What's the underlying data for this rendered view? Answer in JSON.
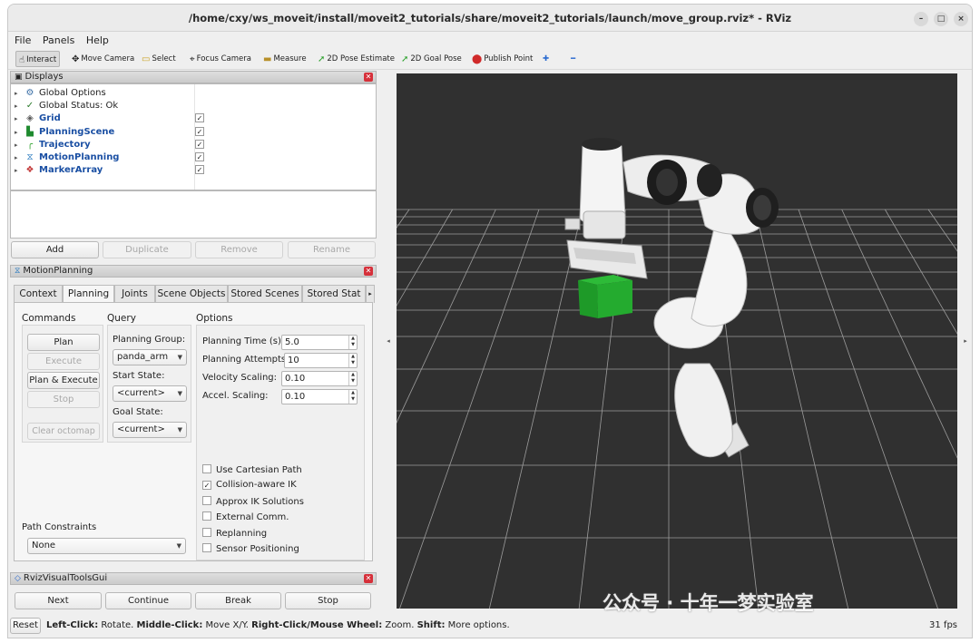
{
  "window": {
    "title": "/home/cxy/ws_moveit/install/moveit2_tutorials/share/moveit2_tutorials/launch/move_group.rviz* - RViz",
    "minimize": "–",
    "maximize": "□",
    "close": "×"
  },
  "menu": [
    "File",
    "Panels",
    "Help"
  ],
  "toolbar": {
    "interact": "Interact",
    "move_camera": "Move Camera",
    "select": "Select",
    "focus_camera": "Focus Camera",
    "measure": "Measure",
    "pose_estimate": "2D Pose Estimate",
    "goal_pose": "2D Goal Pose",
    "publish_point": "Publish Point",
    "plus": "✚",
    "minus": "━"
  },
  "displays": {
    "title": "Displays",
    "items": [
      {
        "label": "Global Options",
        "icon": "gear-icon",
        "glyph": "⚙",
        "color": "#3a6ea5",
        "checked": null
      },
      {
        "label": "Global Status: Ok",
        "icon": "check-icon",
        "glyph": "✓",
        "color": "#2a7a2a",
        "checked": null
      },
      {
        "label": "Grid",
        "icon": "grid-icon",
        "glyph": "◈",
        "color": "#5a5a5a",
        "checked": "✓"
      },
      {
        "label": "PlanningScene",
        "icon": "planning-scene-icon",
        "glyph": "▙",
        "color": "#1e8a2e",
        "checked": "✓"
      },
      {
        "label": "Trajectory",
        "icon": "trajectory-icon",
        "glyph": "╭",
        "color": "#2aa02a",
        "checked": "✓"
      },
      {
        "label": "MotionPlanning",
        "icon": "motion-planning-icon",
        "glyph": "⧖",
        "color": "#2a7ac0",
        "checked": "✓"
      },
      {
        "label": "MarkerArray",
        "icon": "marker-array-icon",
        "glyph": "❖",
        "color": "#c03030",
        "checked": "✓"
      }
    ],
    "buttons": {
      "add": "Add",
      "duplicate": "Duplicate",
      "remove": "Remove",
      "rename": "Rename"
    }
  },
  "motion_planning": {
    "title": "MotionPlanning",
    "tabs": [
      "Context",
      "Planning",
      "Joints",
      "Scene Objects",
      "Stored Scenes",
      "Stored Stat"
    ],
    "active_tab": "Planning",
    "commands_label": "Commands",
    "query_label": "Query",
    "options_label": "Options",
    "plan": "Plan",
    "execute": "Execute",
    "plan_execute": "Plan & Execute",
    "stop": "Stop",
    "clear_octomap": "Clear octomap",
    "planning_group_label": "Planning Group:",
    "planning_group": "panda_arm",
    "start_state_label": "Start State:",
    "start_state": "<current>",
    "goal_state_label": "Goal State:",
    "goal_state": "<current>",
    "planning_time_label": "Planning Time (s):",
    "planning_time": "5.0",
    "planning_attempts_label": "Planning Attempts:",
    "planning_attempts": "10",
    "velocity_scaling_label": "Velocity Scaling:",
    "velocity_scaling": "0.10",
    "accel_scaling_label": "Accel. Scaling:",
    "accel_scaling": "0.10",
    "checkboxes": [
      {
        "label": "Use Cartesian Path",
        "mark": ""
      },
      {
        "label": "Collision-aware IK",
        "mark": "✓"
      },
      {
        "label": "Approx IK Solutions",
        "mark": ""
      },
      {
        "label": "External Comm.",
        "mark": ""
      },
      {
        "label": "Replanning",
        "mark": ""
      },
      {
        "label": "Sensor Positioning",
        "mark": ""
      }
    ],
    "path_constraints_label": "Path Constraints",
    "path_constraints": "None"
  },
  "rviz_visual_tools": {
    "title": "RvizVisualToolsGui",
    "next": "Next",
    "continue": "Continue",
    "break": "Break",
    "stop": "Stop"
  },
  "status": {
    "reset": "Reset",
    "left_click": "Left-Click:",
    "left_click_desc": " Rotate. ",
    "middle_click": "Middle-Click:",
    "middle_click_desc": " Move X/Y. ",
    "right_click": "Right-Click/Mouse Wheel:",
    "right_click_desc": " Zoom. ",
    "shift": "Shift:",
    "shift_desc": " More options.",
    "fps": "31 fps"
  },
  "watermark": "公众号 · 十年一梦实验室",
  "colors": {
    "viewport_bg": "#303030",
    "grid": "#a0a0a0",
    "cube": "#22a52f",
    "highlight": "#1a4fa3",
    "close": "#d6303a"
  }
}
